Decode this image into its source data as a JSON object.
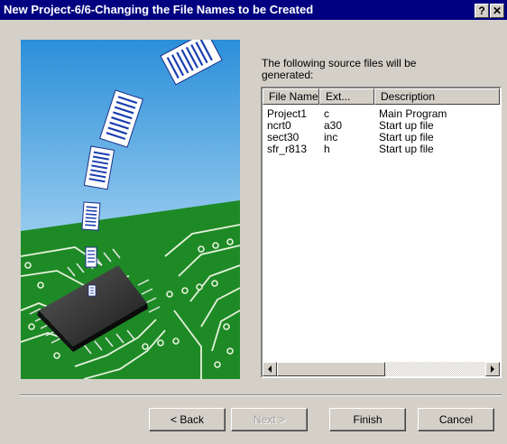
{
  "window": {
    "title": "New Project-6/6-Changing the File Names to be Created",
    "help_label": "?",
    "close_label": "✕"
  },
  "prompt": "The following source files will be generated:",
  "list": {
    "columns": [
      "File Name",
      "Ext...",
      "Description"
    ],
    "rows": [
      {
        "name": "Project1",
        "ext": "c",
        "desc": "Main Program"
      },
      {
        "name": "ncrt0",
        "ext": "a30",
        "desc": "Start up file"
      },
      {
        "name": "sect30",
        "ext": "inc",
        "desc": "Start up file"
      },
      {
        "name": "sfr_r813",
        "ext": "h",
        "desc": "Start up file"
      }
    ]
  },
  "buttons": {
    "back": "< Back",
    "next": "Next >",
    "finish": "Finish",
    "cancel": "Cancel"
  }
}
